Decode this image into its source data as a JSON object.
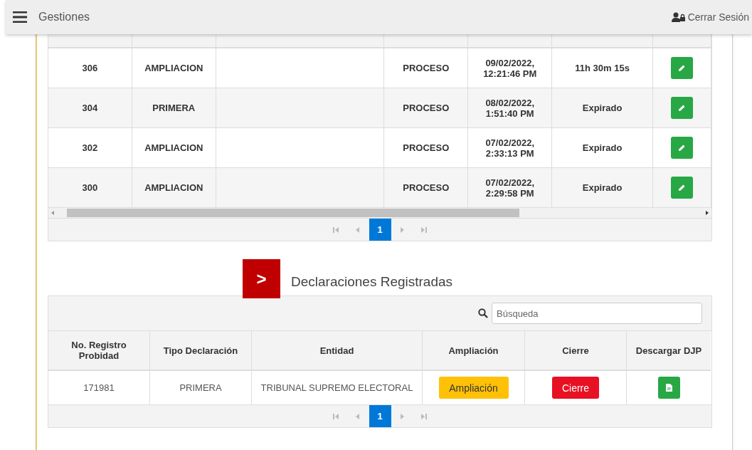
{
  "topbar": {
    "title": "Gestiones",
    "logout": "Cerrar Sesión"
  },
  "gestiones_table": {
    "rows": [
      {
        "cells": [
          "306",
          "AMPLIACION",
          "",
          "PROCESO",
          "09/02/2022,\n12:21:46 PM",
          "11h 30m 15s"
        ]
      },
      {
        "cells": [
          "304",
          "PRIMERA",
          "",
          "PROCESO",
          "08/02/2022,\n1:51:40 PM",
          "Expirado"
        ]
      },
      {
        "cells": [
          "302",
          "AMPLIACION",
          "",
          "PROCESO",
          "07/02/2022,\n2:33:13 PM",
          "Expirado"
        ]
      },
      {
        "cells": [
          "300",
          "AMPLIACION",
          "",
          "PROCESO",
          "07/02/2022,\n2:29:58 PM",
          "Expirado"
        ]
      }
    ],
    "pager": [
      {
        "label": "1",
        "selected": true
      }
    ]
  },
  "declaraciones": {
    "heading_icon": ">",
    "title": "Declaraciones Registradas",
    "search": {
      "placeholder": "Búsqueda"
    },
    "columns": [
      "No. Registro\nProbidad",
      "Tipo Declaración",
      "Entidad",
      "Ampliación",
      "Cierre",
      "Descargar DJP"
    ],
    "rows": [
      {
        "numero": "171981",
        "tipo": "PRIMERA",
        "entidad": "TRIBUNAL SUPREMO ELECTORAL",
        "ampliacion": "Ampliación",
        "cierre": "Cierre"
      }
    ],
    "pager": [
      {
        "label": "1",
        "selected": true
      }
    ]
  }
}
